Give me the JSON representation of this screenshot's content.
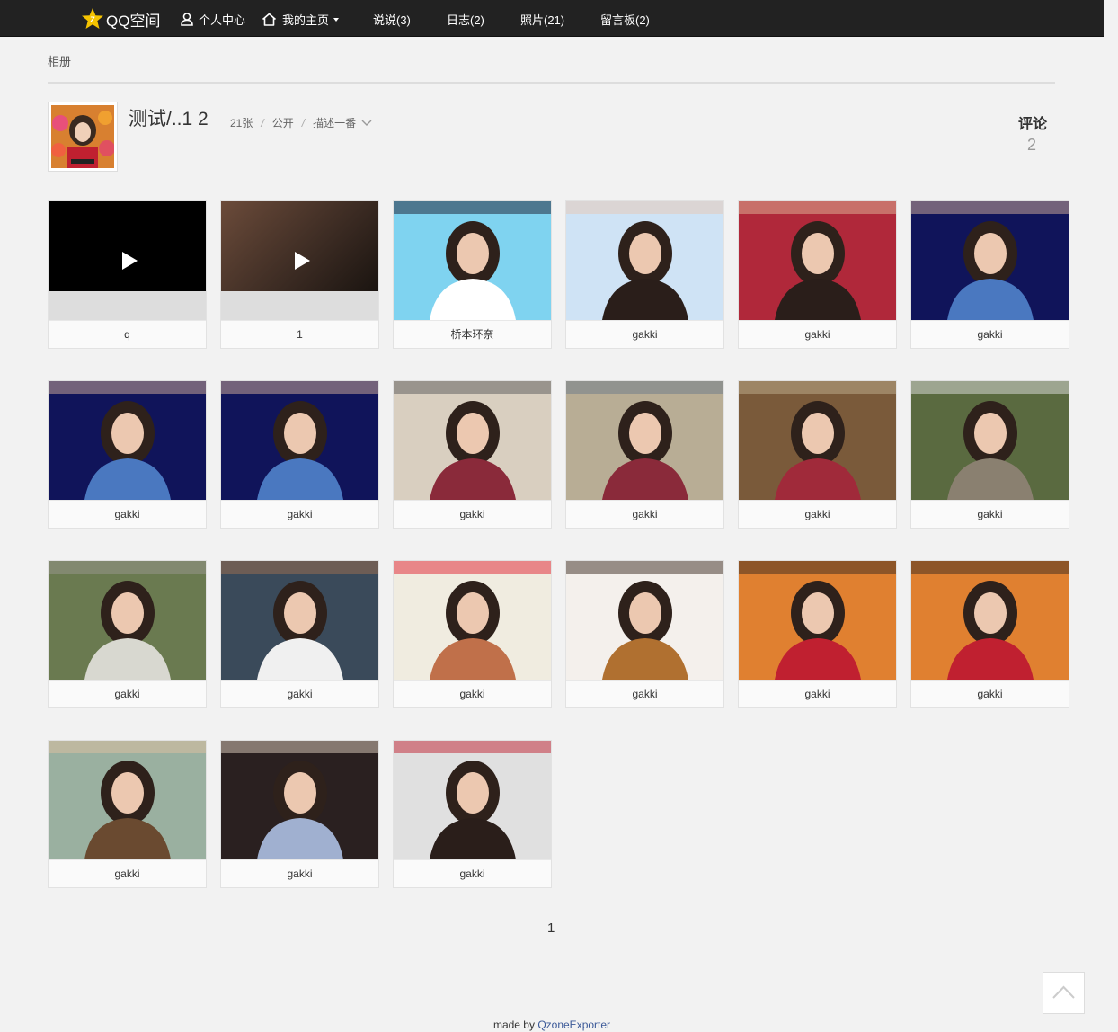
{
  "nav": {
    "brand": "QQ空间",
    "items": [
      {
        "label": "个人中心",
        "icon": "user-icon"
      },
      {
        "label": "我的主页",
        "icon": "home-icon",
        "dropdown": true
      },
      {
        "label": "说说(3)"
      },
      {
        "label": "日志(2)"
      },
      {
        "label": "照片(21)"
      },
      {
        "label": "留言板(2)"
      }
    ]
  },
  "breadcrumb": "相册",
  "album": {
    "title": "测试/..1 2",
    "count": "21张",
    "privacy": "公开",
    "description_toggle": "描述一番",
    "comment_label": "评论",
    "comment_count": "2"
  },
  "photos": [
    {
      "caption": "q",
      "type": "video",
      "palette": [
        "#000000"
      ]
    },
    {
      "caption": "1",
      "type": "video",
      "palette": [
        "#3a2a22",
        "#6b4b3a"
      ]
    },
    {
      "caption": "桥本环奈",
      "type": "photo",
      "palette": [
        "#7fd3f0",
        "#ffffff",
        "#1b1b2e"
      ]
    },
    {
      "caption": "gakki",
      "type": "photo",
      "palette": [
        "#cfe3f5",
        "#2a1e1a",
        "#e8c8b4"
      ]
    },
    {
      "caption": "gakki",
      "type": "photo",
      "palette": [
        "#b0283a",
        "#2a1e1a",
        "#e0b89a"
      ]
    },
    {
      "caption": "gakki",
      "type": "photo",
      "palette": [
        "#10145a",
        "#4a78c0",
        "#d6b09a"
      ]
    },
    {
      "caption": "gakki",
      "type": "photo",
      "palette": [
        "#10145a",
        "#4a78c0",
        "#d6b09a"
      ]
    },
    {
      "caption": "gakki",
      "type": "photo",
      "palette": [
        "#10145a",
        "#4a78c0",
        "#d6b09a"
      ]
    },
    {
      "caption": "gakki",
      "type": "photo",
      "palette": [
        "#d9cfc0",
        "#8a2a3a",
        "#5a5a5a"
      ]
    },
    {
      "caption": "gakki",
      "type": "photo",
      "palette": [
        "#b8ad95",
        "#8a2a3a",
        "#6a7a8a"
      ]
    },
    {
      "caption": "gakki",
      "type": "photo",
      "palette": [
        "#7a5a3a",
        "#a02a3a",
        "#c0b090"
      ]
    },
    {
      "caption": "gakki",
      "type": "photo",
      "palette": [
        "#5a6a40",
        "#8a8070",
        "#e0e0e0"
      ]
    },
    {
      "caption": "gakki",
      "type": "photo",
      "palette": [
        "#6a7a50",
        "#d8d8d0",
        "#9a9890"
      ]
    },
    {
      "caption": "gakki",
      "type": "photo",
      "palette": [
        "#3a4a5a",
        "#f0f0f0",
        "#a07050"
      ]
    },
    {
      "caption": "gakki",
      "type": "photo",
      "palette": [
        "#f0ece0",
        "#c0704a",
        "#e02030"
      ]
    },
    {
      "caption": "gakki",
      "type": "photo",
      "palette": [
        "#f4f0ec",
        "#b07030",
        "#3a2a20"
      ]
    },
    {
      "caption": "gakki",
      "type": "photo",
      "palette": [
        "#e08030",
        "#c02030",
        "#3a2a20"
      ]
    },
    {
      "caption": "gakki",
      "type": "photo",
      "palette": [
        "#e08030",
        "#c02030",
        "#3a2a20"
      ]
    },
    {
      "caption": "gakki",
      "type": "photo",
      "palette": [
        "#9ab0a0",
        "#6a4a30",
        "#e0c0a0"
      ]
    },
    {
      "caption": "gakki",
      "type": "photo",
      "palette": [
        "#2a2020",
        "#a0b0d0",
        "#e0d0c0"
      ]
    },
    {
      "caption": "gakki",
      "type": "photo",
      "palette": [
        "#e0e0e0",
        "#2a1e1a",
        "#c02030"
      ]
    }
  ],
  "pagination": {
    "current": "1"
  },
  "footer": {
    "prefix": "made by",
    "link": "QzoneExporter"
  },
  "colors": {
    "topbar": "#222222",
    "background": "#f2f2f2",
    "link": "#3b5998",
    "star": "#f5c400"
  }
}
